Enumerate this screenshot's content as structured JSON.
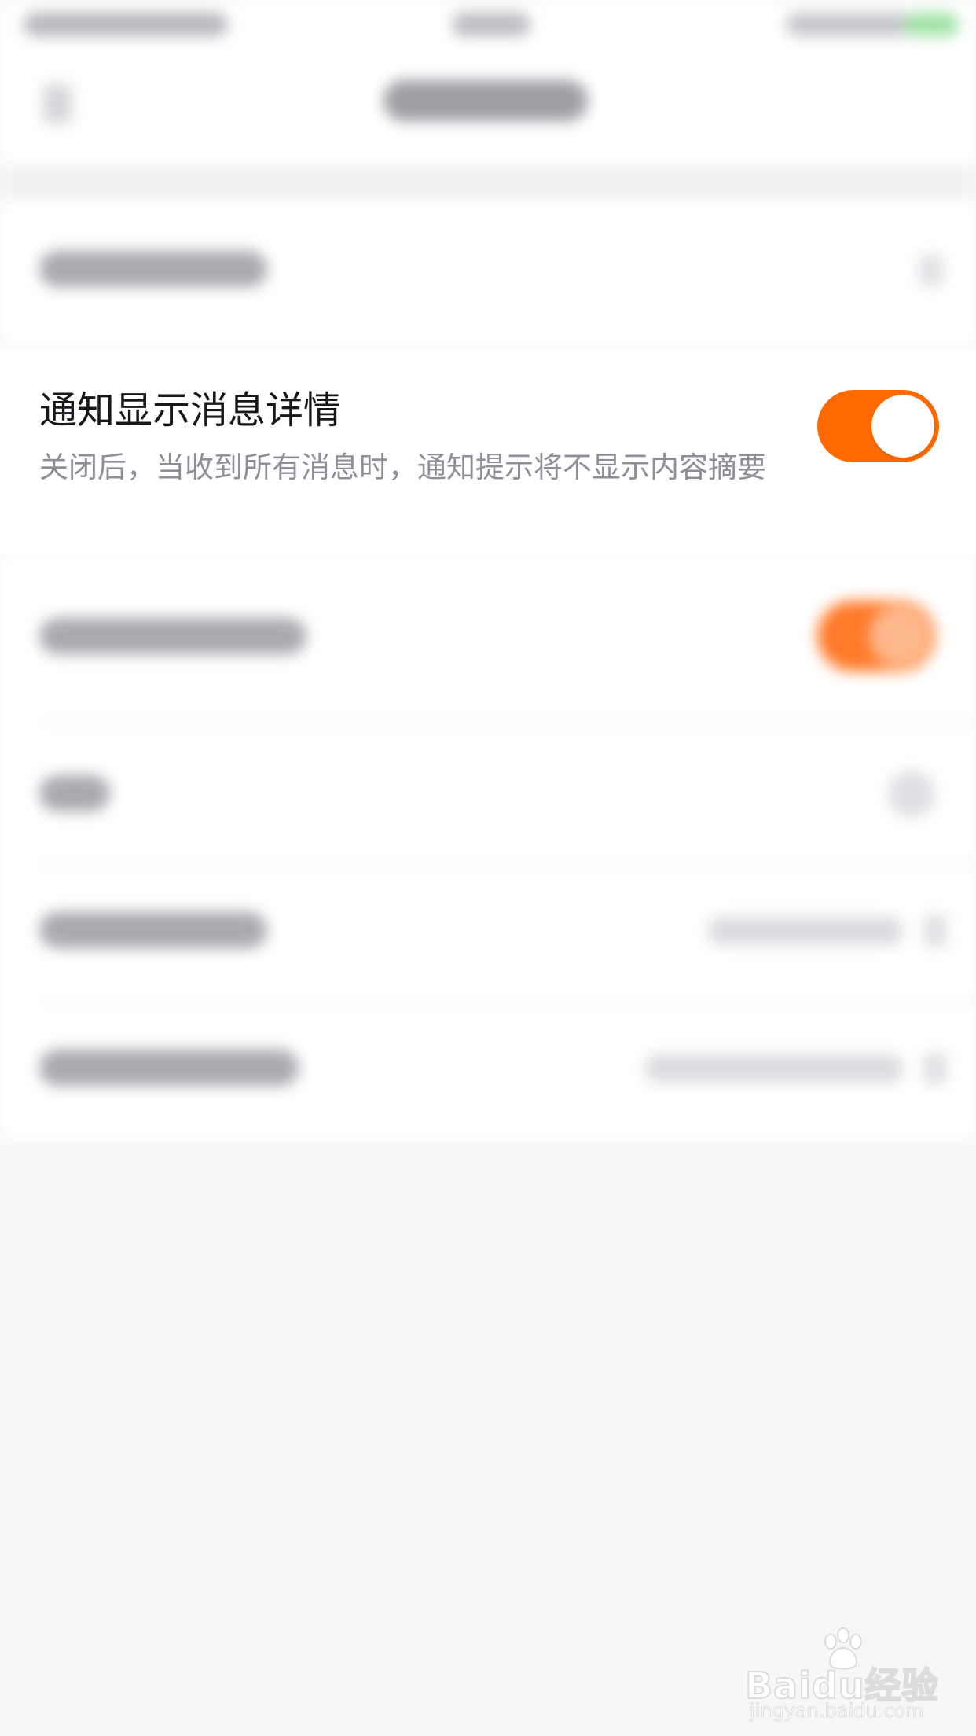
{
  "notification_setting": {
    "title": "通知显示消息详情",
    "description": "关闭后，当收到所有消息时，通知提示将不显示内容摘要",
    "toggle_on": true
  },
  "watermark": {
    "logo": "Baidu经验",
    "url": "jingyan.baidu.com"
  },
  "colors": {
    "accent": "#ff6a00",
    "title_text": "#17181c",
    "description_text": "#8d8f98",
    "page_background": "#f7f7f8"
  }
}
